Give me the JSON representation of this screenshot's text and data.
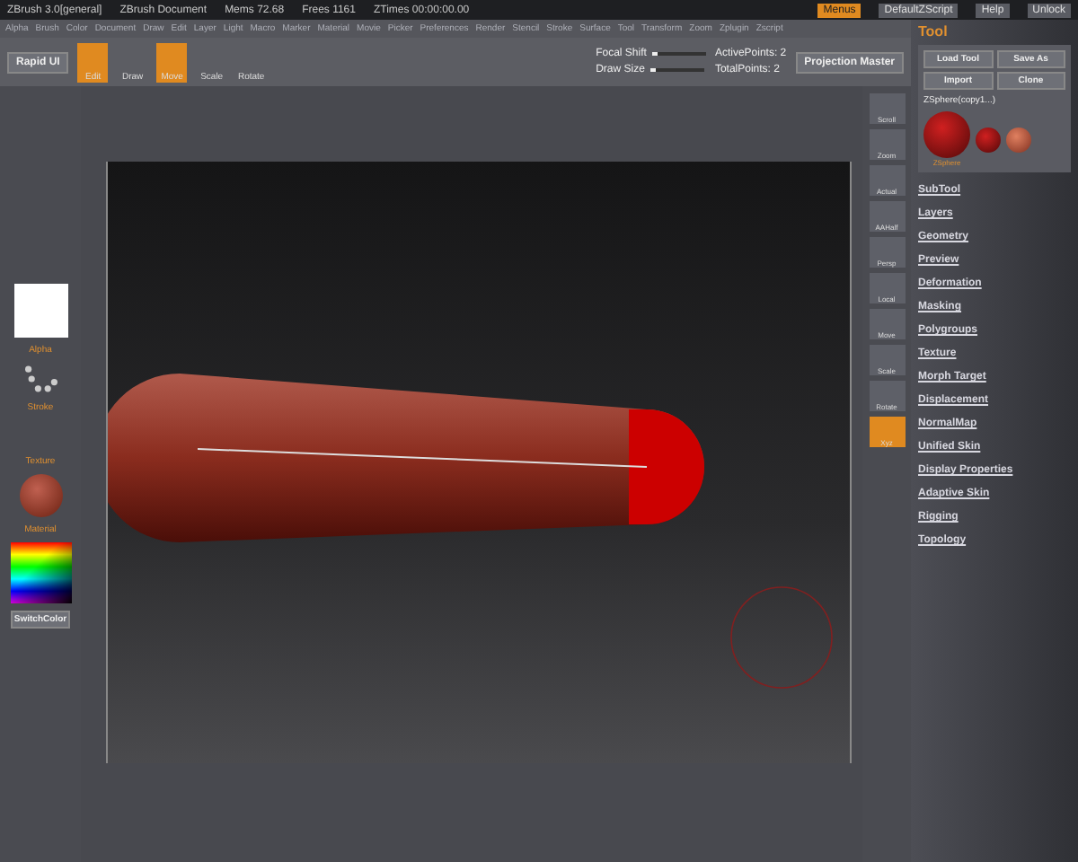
{
  "title_bar": {
    "app": "ZBrush 3.0[general]",
    "document": "ZBrush Document",
    "stats": [
      "Mems 72.68",
      "Frees 1161",
      "ZTimes 00:00:00.00"
    ],
    "buttons": [
      {
        "label": "Menus",
        "selected": true
      },
      {
        "label": "DefaultZScript",
        "selected": false
      },
      {
        "label": "Help",
        "selected": false
      },
      {
        "label": "Unlock",
        "selected": false
      }
    ]
  },
  "menu": [
    "Alpha",
    "Brush",
    "Color",
    "Document",
    "Draw",
    "Edit",
    "Layer",
    "Light",
    "Macro",
    "Marker",
    "Material",
    "Movie",
    "Picker",
    "Preferences",
    "Render",
    "Stencil",
    "Stroke",
    "Surface",
    "Tool",
    "Transform",
    "Zoom",
    "Zplugin",
    "Zscript"
  ],
  "toolbar": {
    "rapid_ui": "Rapid UI",
    "tools": [
      {
        "label": "Edit",
        "selected": true
      },
      {
        "label": "Draw",
        "selected": false
      },
      {
        "label": "Move",
        "selected": true
      },
      {
        "label": "Scale",
        "selected": false
      },
      {
        "label": "Rotate",
        "selected": false
      }
    ],
    "sliders": [
      {
        "label": "Focal Shift",
        "level": 0.1
      },
      {
        "label": "Draw Size",
        "level": 0.1
      }
    ],
    "points": [
      "ActivePoints: 2",
      "TotalPoints: 2"
    ],
    "projection_master": "Projection Master"
  },
  "left_panel": {
    "alpha": "Alpha",
    "stroke": "Stroke",
    "texture": "Texture",
    "material": "Material",
    "switch_color": "SwitchColor"
  },
  "right_toolbar": [
    {
      "label": "Scroll",
      "selected": false
    },
    {
      "label": "Zoom",
      "selected": false
    },
    {
      "label": "Actual",
      "selected": false
    },
    {
      "label": "AAHalf",
      "selected": false
    },
    {
      "label": "Persp",
      "selected": false
    },
    {
      "label": "Local",
      "selected": false
    },
    {
      "label": "Move",
      "selected": false
    },
    {
      "label": "Scale",
      "selected": false
    },
    {
      "label": "Rotate",
      "selected": false
    },
    {
      "label": "Xyz",
      "selected": true
    }
  ],
  "tool_panel": {
    "title": "Tool",
    "buttons": [
      "Load Tool",
      "Save As",
      "Import",
      "Clone"
    ],
    "current_tool": "ZSphere(copy1...)",
    "thumb_label": "ZSphere",
    "sections": [
      "SubTool",
      "Layers",
      "Geometry",
      "Preview",
      "Deformation",
      "Masking",
      "Polygroups",
      "Texture",
      "Morph Target",
      "Displacement",
      "NormalMap",
      "Unified Skin",
      "Display Properties",
      "Adaptive Skin",
      "Rigging",
      "Topology"
    ]
  }
}
